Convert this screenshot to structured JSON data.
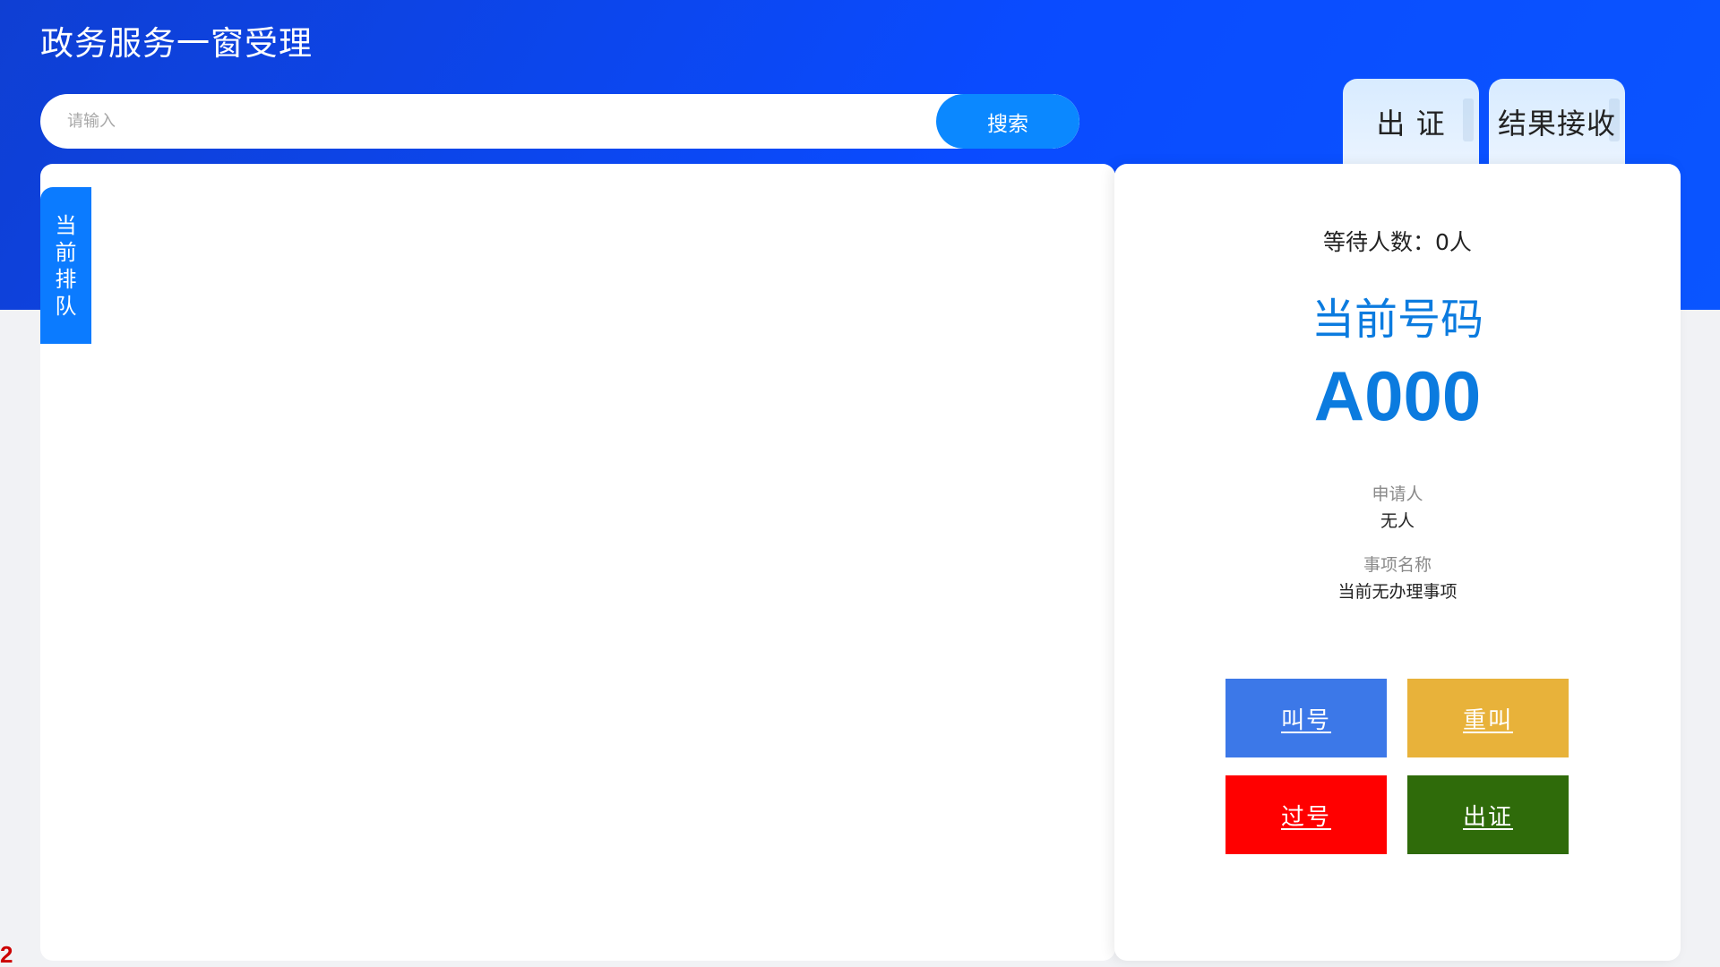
{
  "header": {
    "title": "政务服务一窗受理"
  },
  "search": {
    "placeholder": "请输入",
    "button_label": "搜索"
  },
  "top_tabs": [
    {
      "label": "出 证"
    },
    {
      "label": "结果接收"
    }
  ],
  "queue": {
    "tab_label": "当前排队"
  },
  "panel": {
    "waiting_count": "等待人数：0人",
    "current_label": "当前号码",
    "current_number": "A000",
    "applicant_label": "申请人",
    "applicant_value": "无人",
    "item_label": "事项名称",
    "item_value": "当前无办理事项"
  },
  "actions": {
    "call": "叫号",
    "recall": "重叫",
    "skip": "过号",
    "issue": "出证"
  },
  "page_marker": "2",
  "colors": {
    "header_blue": "#0a4bff",
    "accent_blue": "#0b7bdf",
    "call_button": "#3c78e8",
    "recall_button": "#e8b23a",
    "skip_button": "#ff0000",
    "issue_button": "#2f6b0a"
  }
}
